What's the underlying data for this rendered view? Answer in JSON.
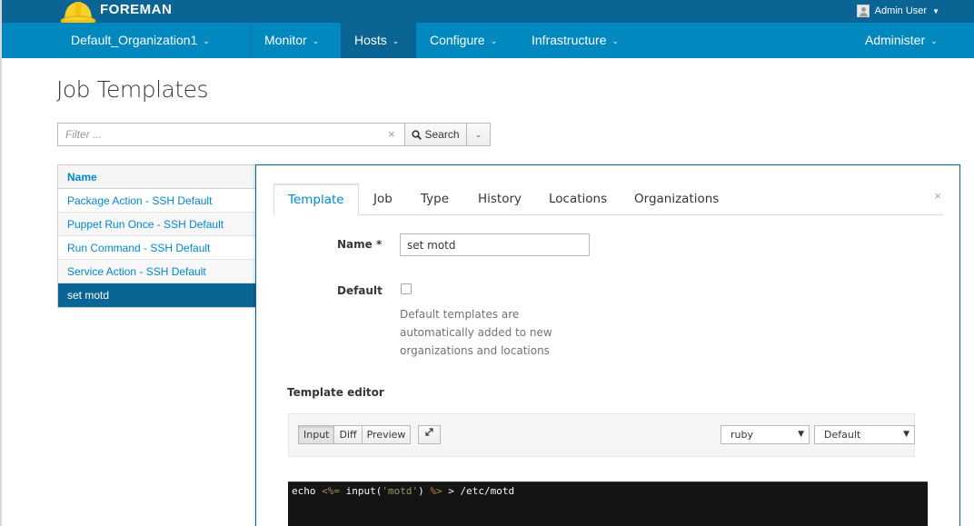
{
  "app": {
    "brand": "FOREMAN",
    "user": "Admin User"
  },
  "nav": {
    "organization": "Default_Organization1",
    "monitor": "Monitor",
    "hosts": "Hosts",
    "configure": "Configure",
    "infrastructure": "Infrastructure",
    "administer": "Administer"
  },
  "page": {
    "title": "Job Templates"
  },
  "search": {
    "placeholder": "Filter ...",
    "value": "",
    "button": "Search"
  },
  "list": {
    "header": "Name",
    "items": [
      "Package Action - SSH Default",
      "Puppet Run Once - SSH Default",
      "Run Command - SSH Default",
      "Service Action - SSH Default",
      "set motd"
    ],
    "selected": "set motd"
  },
  "editor": {
    "tabs": [
      "Template",
      "Job",
      "Type",
      "History",
      "Locations",
      "Organizations"
    ],
    "active_tab": "Template",
    "name_label": "Name *",
    "name_value": "set motd",
    "default_label": "Default",
    "default_checked": false,
    "default_help": "Default templates are automatically added to new organizations and locations",
    "editor_label": "Template editor",
    "modes": [
      "Input",
      "Diff",
      "Preview"
    ],
    "active_mode": "Input",
    "syntax": "ruby",
    "theme": "Default",
    "code": {
      "part1": "echo ",
      "open_tag": "<%=",
      "part2": " input(",
      "string": "'motd'",
      "part3": ") ",
      "close_tag": "%>",
      "part4": " > /etc/motd"
    }
  },
  "colors": {
    "topbar": "#0a6595",
    "navbar": "#0188bf",
    "link": "#0088ce",
    "selected_row": "#0a6595"
  }
}
